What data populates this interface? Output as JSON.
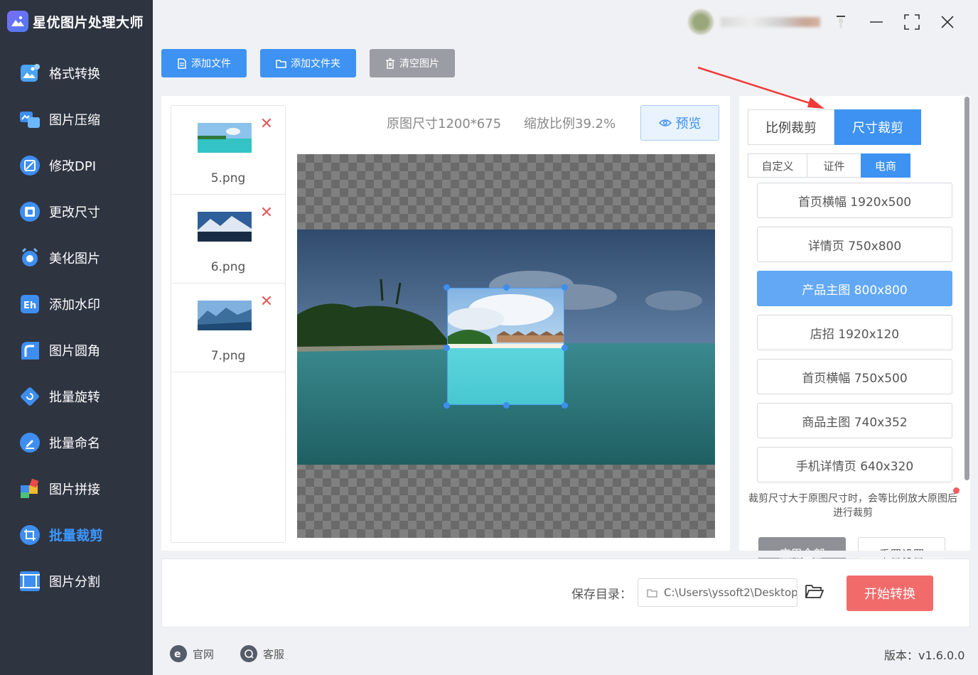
{
  "app": {
    "title": "星优图片处理大师"
  },
  "nav": [
    {
      "label": "格式转换",
      "icon": "image-convert-icon"
    },
    {
      "label": "图片压缩",
      "icon": "image-compress-icon"
    },
    {
      "label": "修改DPI",
      "icon": "dpi-icon"
    },
    {
      "label": "更改尺寸",
      "icon": "resize-icon"
    },
    {
      "label": "美化图片",
      "icon": "beautify-icon"
    },
    {
      "label": "添加水印",
      "icon": "watermark-icon"
    },
    {
      "label": "图片圆角",
      "icon": "rounded-corner-icon"
    },
    {
      "label": "批量旋转",
      "icon": "rotate-icon"
    },
    {
      "label": "批量命名",
      "icon": "rename-icon"
    },
    {
      "label": "图片拼接",
      "icon": "puzzle-icon"
    },
    {
      "label": "批量裁剪",
      "icon": "crop-icon",
      "active": true
    },
    {
      "label": "图片分割",
      "icon": "split-icon"
    }
  ],
  "toolbar": {
    "add_file": "添加文件",
    "add_folder": "添加文件夹",
    "clear": "清空图片"
  },
  "files": [
    {
      "name": "5.png"
    },
    {
      "name": "6.png"
    },
    {
      "name": "7.png"
    }
  ],
  "image_info": {
    "size": "原图尺寸1200*675",
    "scale": "缩放比例39.2%"
  },
  "preview_label": "预览",
  "crop_modes": {
    "ratio": "比例裁剪",
    "size": "尺寸裁剪"
  },
  "sub_tabs": {
    "custom": "自定义",
    "id_photo": "证件",
    "ecommerce": "电商"
  },
  "presets": [
    {
      "label": "首页横幅 1920x500"
    },
    {
      "label": "详情页 750x800"
    },
    {
      "label": "产品主图 800x800",
      "active": true
    },
    {
      "label": "店招 1920x120"
    },
    {
      "label": "首页横幅 750x500"
    },
    {
      "label": "商品主图 740x352"
    },
    {
      "label": "手机详情页 640x320"
    }
  ],
  "note": "裁剪尺寸大于原图尺寸时，会等比例放大原图后进行裁剪",
  "actions": {
    "apply_all": "应用全部",
    "reset": "重置设置"
  },
  "save": {
    "label": "保存目录：",
    "path": "C:\\Users\\yssoft2\\Desktop"
  },
  "start_label": "开始转换",
  "footer": {
    "website": "官网",
    "support": "客服",
    "version": "版本：v1.6.0.0"
  },
  "colors": {
    "accent": "#3d92f2",
    "sidebar": "#2f3441",
    "start": "#f26b6b",
    "delete": "#e55b5b"
  }
}
